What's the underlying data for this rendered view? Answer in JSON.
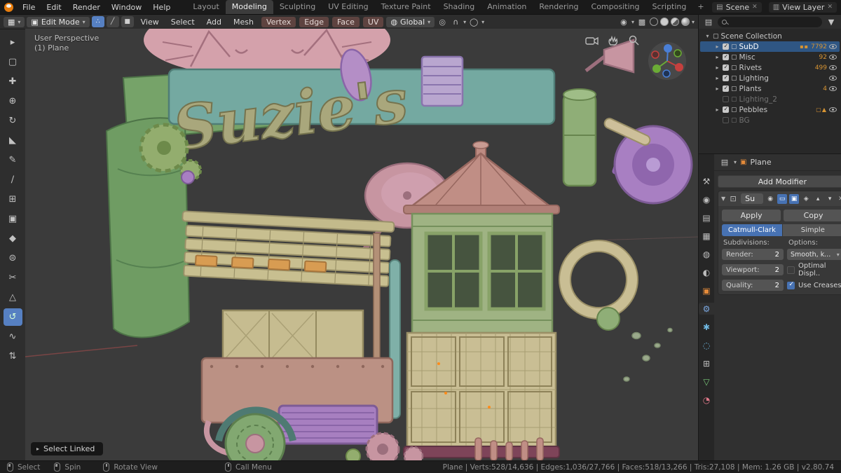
{
  "topbar": {
    "menus": [
      "File",
      "Edit",
      "Render",
      "Window",
      "Help"
    ],
    "workspaces": [
      "Layout",
      "Modeling",
      "Sculpting",
      "UV Editing",
      "Texture Paint",
      "Shading",
      "Animation",
      "Rendering",
      "Compositing",
      "Scripting"
    ],
    "active_workspace": "Modeling",
    "new_workspace": "+",
    "scene_label": "Scene",
    "view_layer_label": "View Layer"
  },
  "vheader": {
    "mode": "Edit Mode",
    "menus": [
      "View",
      "Select",
      "Add",
      "Mesh"
    ],
    "element_menus": [
      "Vertex",
      "Edge",
      "Face",
      "UV"
    ],
    "orientation": "Global"
  },
  "tools": [
    {
      "name": "tweak",
      "glyph": "▸"
    },
    {
      "name": "select-box",
      "glyph": "▢"
    },
    {
      "name": "cursor",
      "glyph": "✚"
    },
    {
      "name": "move",
      "glyph": "⊕"
    },
    {
      "name": "rotate",
      "glyph": "↻"
    },
    {
      "name": "scale",
      "glyph": "◣"
    },
    {
      "name": "annotate",
      "glyph": "✎"
    },
    {
      "name": "measure",
      "glyph": "∕"
    },
    {
      "name": "extrude-region",
      "glyph": "⊞"
    },
    {
      "name": "inset-faces",
      "glyph": "▣"
    },
    {
      "name": "bevel",
      "glyph": "◆"
    },
    {
      "name": "loop-cut",
      "glyph": "⊜"
    },
    {
      "name": "knife",
      "glyph": "✂"
    },
    {
      "name": "poly-build",
      "glyph": "△"
    },
    {
      "name": "spin",
      "glyph": "↺"
    },
    {
      "name": "smooth",
      "glyph": "∿"
    },
    {
      "name": "edge-slide",
      "glyph": "⇅"
    }
  ],
  "viewport": {
    "view_label": "User Perspective",
    "object_label": "(1) Plane",
    "operator_label": "Select Linked",
    "sign_text": "Suzie's"
  },
  "outliner": {
    "root_label": "Scene Collection",
    "items": [
      {
        "label": "SubD",
        "badge": "▪▪",
        "count": "7792"
      },
      {
        "label": "Misc",
        "badge": "",
        "count": "92"
      },
      {
        "label": "Rivets",
        "badge": "",
        "count": "499"
      },
      {
        "label": "Lighting",
        "badge": "",
        "count": ""
      },
      {
        "label": "Plants",
        "badge": "",
        "count": "4"
      },
      {
        "label": "Lighting_2",
        "badge": "",
        "count": ""
      },
      {
        "label": "Pebbles",
        "badge": "▢▲",
        "count": ""
      },
      {
        "label": "BG",
        "badge": "",
        "count": ""
      }
    ]
  },
  "properties": {
    "tabs": [
      {
        "name": "active-tool",
        "glyph": "⚒",
        "color": "#bdbdbd"
      },
      {
        "name": "render",
        "glyph": "◉",
        "color": "#bdbdbd"
      },
      {
        "name": "output",
        "glyph": "▤",
        "color": "#bdbdbd"
      },
      {
        "name": "view-layer",
        "glyph": "▦",
        "color": "#bdbdbd"
      },
      {
        "name": "scene",
        "glyph": "◍",
        "color": "#bdbdbd"
      },
      {
        "name": "world",
        "glyph": "◐",
        "color": "#bdbdbd"
      },
      {
        "name": "object",
        "glyph": "▣",
        "color": "#e58b3a"
      },
      {
        "name": "modifiers",
        "glyph": "⚙",
        "color": "#7aa7e0"
      },
      {
        "name": "particles",
        "glyph": "✱",
        "color": "#6fb7e0"
      },
      {
        "name": "physics",
        "glyph": "◌",
        "color": "#6fb7e0"
      },
      {
        "name": "constraints",
        "glyph": "⊞",
        "color": "#bdbdbd"
      },
      {
        "name": "object-data",
        "glyph": "▽",
        "color": "#79c879"
      },
      {
        "name": "material",
        "glyph": "◔",
        "color": "#e0788a"
      }
    ],
    "breadcrumb_object": "Plane",
    "add_modifier_label": "Add Modifier",
    "modifier": {
      "name": "Su",
      "apply_label": "Apply",
      "copy_label": "Copy",
      "algo_left": "Catmull-Clark",
      "algo_right": "Simple",
      "subdivisions_label": "Subdivisions:",
      "options_label": "Options:",
      "fields": [
        {
          "label": "Render:",
          "value": "2"
        },
        {
          "label": "Viewport:",
          "value": "2"
        },
        {
          "label": "Quality:",
          "value": "2"
        }
      ],
      "uv_smooth": "Smooth, keep c...",
      "optimal_label": "Optimal Displ..",
      "creases_label": "Use Creases"
    }
  },
  "statusbar": {
    "select_label": "Select",
    "spin_label": "Spin",
    "rotate_label": "Rotate View",
    "menu_label": "Call Menu",
    "stats": "Plane | Verts:528/14,636 | Edges:1,036/27,766 | Faces:518/13,266 | Tris:27,108 | Mem: 1.26 GB | v2.80.74"
  },
  "glyphs": {
    "caret": "▾",
    "editor_grid": "▦",
    "mode_cube": "▣",
    "vertex_mode": "∴",
    "edge_mode": "╱",
    "face_mode": "■",
    "orientation": "◍",
    "pivot": "◎",
    "magnet": "∩",
    "proportional": "◯",
    "overlays": "◉",
    "xray": "▩",
    "tri_right": "▸",
    "tri_down": "▾",
    "box": "▢",
    "outliner_editor": "▤",
    "funnel": "▼",
    "props_editor": "▤",
    "expand": "▼",
    "modifier": "⊡",
    "mod_render": "◉",
    "mod_realtime": "▭",
    "mod_edit": "▣",
    "mod_cage": "◈",
    "up": "▴",
    "down": "▾",
    "close": "✕",
    "scene_icon": "▤",
    "layers_icon": "▥"
  }
}
